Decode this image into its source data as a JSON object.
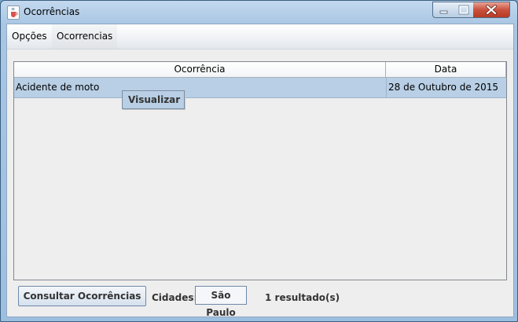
{
  "window": {
    "title": "Ocorrências"
  },
  "menubar": {
    "items": [
      {
        "label": "Opções"
      },
      {
        "label": "Ocorrencias"
      }
    ]
  },
  "table": {
    "columns": [
      "Ocorrência",
      "Data"
    ],
    "rows": [
      {
        "ocorrencia": "Acidente de moto",
        "data": "28 de Outubro de 2015",
        "selected": true
      }
    ]
  },
  "context_menu": {
    "items": [
      {
        "label": "Visualizar"
      }
    ]
  },
  "footer": {
    "consult_button": "Consultar Ocorrências",
    "cities_label": "Cidades:",
    "city_value": "São Paulo",
    "result_count": "1 resultado(s)"
  },
  "icons": {
    "app": "java-cup-icon",
    "minimize": "minimize-icon",
    "maximize": "maximize-icon",
    "close": "close-icon"
  },
  "colors": {
    "selection": "#b8cfe5",
    "close_button": "#c9513c",
    "title_bar": "#a9c6e3"
  }
}
